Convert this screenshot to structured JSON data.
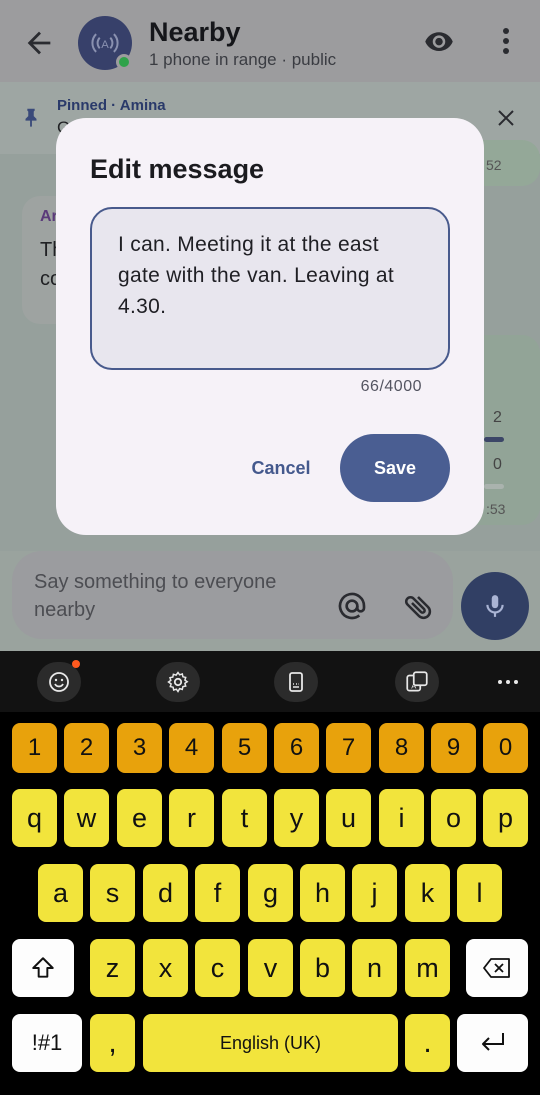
{
  "header": {
    "title": "Nearby",
    "subtitle": "1 phone in range · public"
  },
  "pinned": {
    "label": "Pinned · Amina",
    "text": "G"
  },
  "chat": {
    "left_bubble_name": "Ar",
    "left_bubble_line1": "Th",
    "left_bubble_line2": "co",
    "right_top_time": "52",
    "poll_count_1": "2",
    "poll_count_2": "0",
    "poll_time": ":53"
  },
  "composer": {
    "placeholder": "Say something to everyone nearby"
  },
  "dialog": {
    "title": "Edit message",
    "message_text": "I can. Meeting it at the east gate with the van. Leaving at 4.30.",
    "char_count": "66/4000",
    "cancel_label": "Cancel",
    "save_label": "Save"
  },
  "keyboard": {
    "numbers": [
      "1",
      "2",
      "3",
      "4",
      "5",
      "6",
      "7",
      "8",
      "9",
      "0"
    ],
    "row1": [
      "q",
      "w",
      "e",
      "r",
      "t",
      "y",
      "u",
      "i",
      "o",
      "p"
    ],
    "row2": [
      "a",
      "s",
      "d",
      "f",
      "g",
      "h",
      "j",
      "k",
      "l"
    ],
    "row3": [
      "z",
      "x",
      "c",
      "v",
      "b",
      "n",
      "m"
    ],
    "symbols_label": "!#1",
    "comma": ",",
    "space_label": "English (UK)",
    "period": "."
  },
  "colors": {
    "accent": "#4a5e92",
    "number_keys": "#e8a20c",
    "letter_keys": "#f2e43c",
    "notification_dot": "#ff5a1f"
  }
}
